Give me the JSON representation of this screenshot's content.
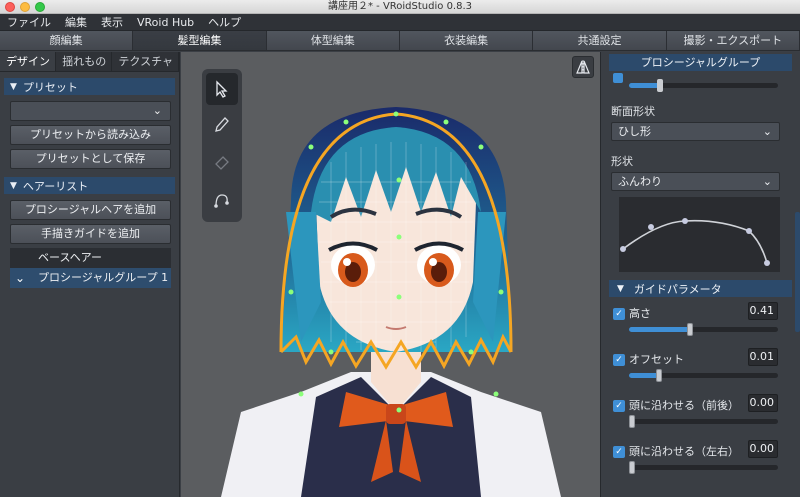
{
  "window": {
    "title": "講座用２* - VRoidStudio 0.8.3"
  },
  "menubar": [
    "ファイル",
    "編集",
    "表示",
    "VRoid Hub",
    "ヘルプ"
  ],
  "main_tabs": [
    "顔編集",
    "髪型編集",
    "体型編集",
    "衣装編集",
    "共通設定",
    "撮影・エクスポート"
  ],
  "active_main_tab": "髪型編集",
  "left_panel": {
    "subtabs": [
      "デザイン",
      "揺れもの",
      "テクスチャ"
    ],
    "preset": {
      "header": "プリセット",
      "load_button": "プリセットから読み込み",
      "save_button": "プリセットとして保存"
    },
    "hair_list": {
      "header": "ヘアーリスト",
      "add_procedural_button": "プロシージャルヘアを追加",
      "add_guide_button": "手描きガイドを追加",
      "items": [
        "ベースヘアー",
        "プロシージャルグループ 1"
      ]
    }
  },
  "right_panel": {
    "group_header": "プロシージャルグループ",
    "cross_section_label": "断面形状",
    "cross_section_value": "ひし形",
    "shape_label": "形状",
    "shape_value": "ふんわり",
    "guide_params_header": "ガイドパラメータ",
    "params": [
      {
        "label": "高さ",
        "value": "0.41",
        "fraction": 0.41
      },
      {
        "label": "オフセット",
        "value": "0.01",
        "fraction": 0.2
      },
      {
        "label": "頭に沿わせる（前後）",
        "value": "0.00",
        "fraction": 0.0
      },
      {
        "label": "頭に沿わせる（左右）",
        "value": "0.00",
        "fraction": 0.0
      }
    ]
  },
  "colors": {
    "accent": "#3f8fd6",
    "section": "#2c4a6b",
    "outline": "#f5a623"
  },
  "icons": [
    "select-arrow-icon",
    "pen-icon",
    "eraser-icon",
    "curve-icon",
    "mirror-icon",
    "chevron-down-icon",
    "checkmark-icon"
  ]
}
